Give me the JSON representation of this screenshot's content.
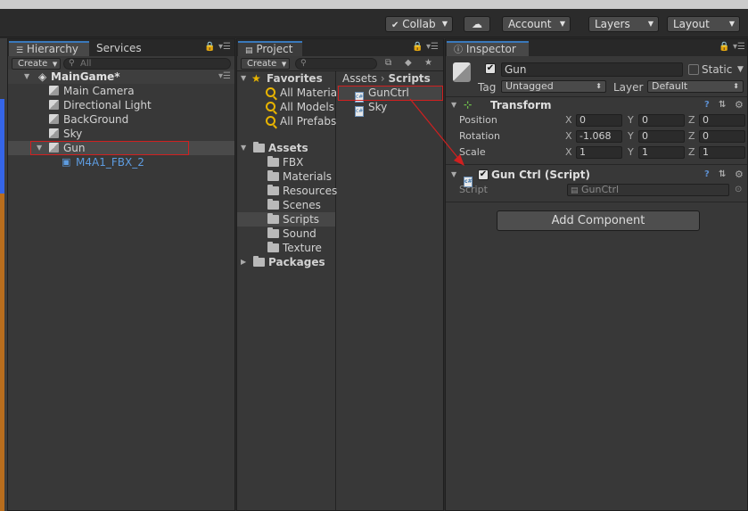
{
  "toolbar": {
    "collab_label": "Collab",
    "account_label": "Account",
    "layers_label": "Layers",
    "layout_label": "Layout"
  },
  "hierarchy": {
    "tab_label": "Hierarchy",
    "services_tab_label": "Services",
    "create_label": "Create",
    "search_placeholder": "All",
    "scene_name": "MainGame*",
    "items": [
      {
        "label": "Main Camera"
      },
      {
        "label": "Directional Light"
      },
      {
        "label": "BackGround"
      },
      {
        "label": "Sky"
      },
      {
        "label": "Gun"
      },
      {
        "label": "M4A1_FBX_2"
      }
    ]
  },
  "project": {
    "tab_label": "Project",
    "create_label": "Create",
    "favorites_label": "Favorites",
    "favorites": [
      "All Material",
      "All Models",
      "All Prefabs"
    ],
    "assets_label": "Assets",
    "folders": [
      "FBX",
      "Materials",
      "Resources",
      "Scenes",
      "Scripts",
      "Sound",
      "Texture"
    ],
    "packages_label": "Packages",
    "breadcrumb": {
      "root": "Assets",
      "current": "Scripts"
    },
    "files": [
      "GunCtrl",
      "Sky"
    ]
  },
  "inspector": {
    "tab_label": "Inspector",
    "object_name": "Gun",
    "static_label": "Static",
    "tag_label": "Tag",
    "tag_value": "Untagged",
    "layer_label": "Layer",
    "layer_value": "Default",
    "transform": {
      "title": "Transform",
      "position_label": "Position",
      "rotation_label": "Rotation",
      "scale_label": "Scale",
      "axis_x": "X",
      "axis_y": "Y",
      "axis_z": "Z",
      "position": {
        "x": "0",
        "y": "0",
        "z": "0"
      },
      "rotation": {
        "x": "-1.068",
        "y": "0",
        "z": "0"
      },
      "scale": {
        "x": "1",
        "y": "1",
        "z": "1"
      }
    },
    "script_component": {
      "title": "Gun Ctrl (Script)",
      "script_label": "Script",
      "script_value": "GunCtrl"
    },
    "add_component_label": "Add Component"
  },
  "colors": {
    "highlight_red": "#d02020",
    "tab_accent": "#3a79bb",
    "prefab_blue": "#5e9ce0"
  }
}
